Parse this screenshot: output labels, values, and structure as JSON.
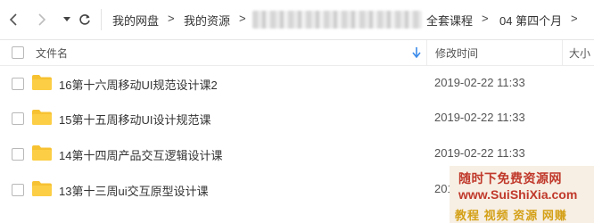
{
  "breadcrumb": {
    "items": [
      "我的网盘",
      "我的资源",
      "全套课程",
      "04 第四个月"
    ],
    "separator": ">"
  },
  "header": {
    "col_name": "文件名",
    "col_modified": "修改时间",
    "col_size": "大小"
  },
  "files": [
    {
      "name": "16第十六周移动UI规范设计课2",
      "modified": "2019-02-22 11:33",
      "icon": "folder-icon"
    },
    {
      "name": "15第十五周移动UI设计规范课",
      "modified": "2019-02-22 11:33",
      "icon": "folder-icon"
    },
    {
      "name": "14第十四周产品交互逻辑设计课",
      "modified": "2019-02-22 11:33",
      "icon": "folder-icon"
    },
    {
      "name": "13第十三周ui交互原型设计课",
      "modified": "201",
      "icon": "folder-icon"
    }
  ],
  "watermark": {
    "line1": "随时下免费资源网",
    "line2": "www.SuiShiXia.com",
    "line3": "教程 视频 资源 网赚"
  },
  "colors": {
    "folder": "#f7c232",
    "watermark_red": "#c0392b",
    "watermark_gold": "#d4a017",
    "sort_arrow": "#3b8bea"
  }
}
